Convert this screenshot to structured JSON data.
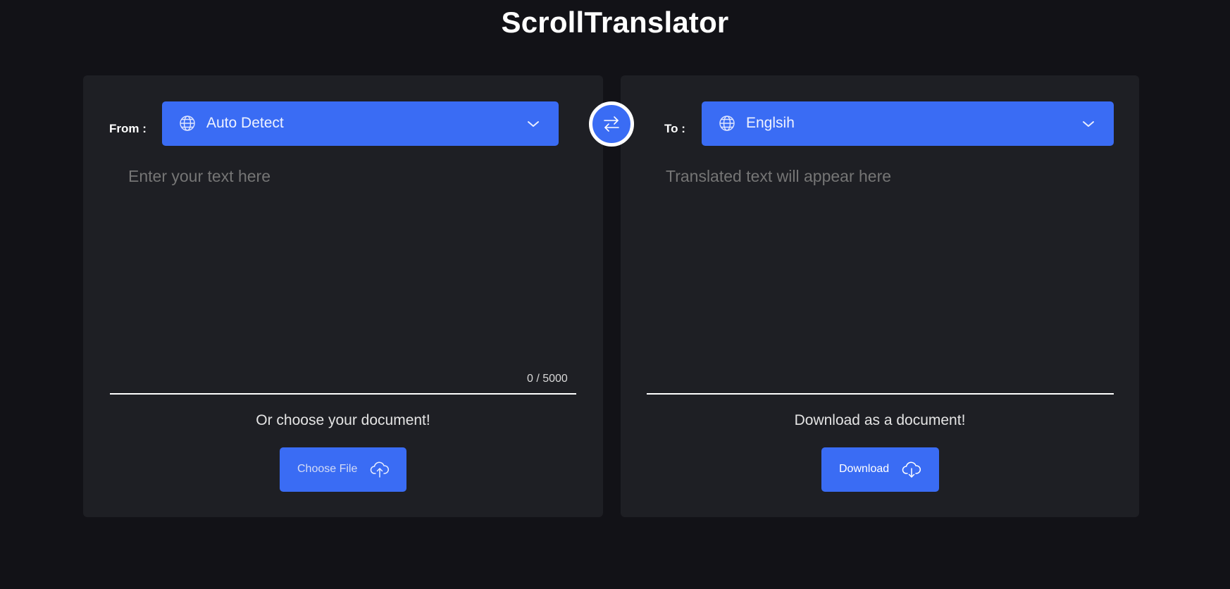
{
  "app": {
    "title": "ScrollTranslator"
  },
  "source": {
    "label": "From :",
    "language": "Auto Detect",
    "placeholder": "Enter your text here",
    "counter": "0 / 5000",
    "doc_caption": "Or choose your document!",
    "button_label": "Choose File"
  },
  "target": {
    "label": "To :",
    "language": "Englsih",
    "placeholder": "Translated text will appear here",
    "doc_caption": "Download as a document!",
    "button_label": "Download"
  },
  "icons": {
    "language_select": "globe-icon",
    "dropdown": "chevron-down-icon",
    "swap": "swap-arrows-icon",
    "upload": "cloud-upload-icon",
    "download": "cloud-download-icon"
  },
  "colors": {
    "background": "#121217",
    "panel": "#1e1f24",
    "accent": "#3a6cf4",
    "text": "#ffffff",
    "placeholder": "#7a7b80"
  }
}
